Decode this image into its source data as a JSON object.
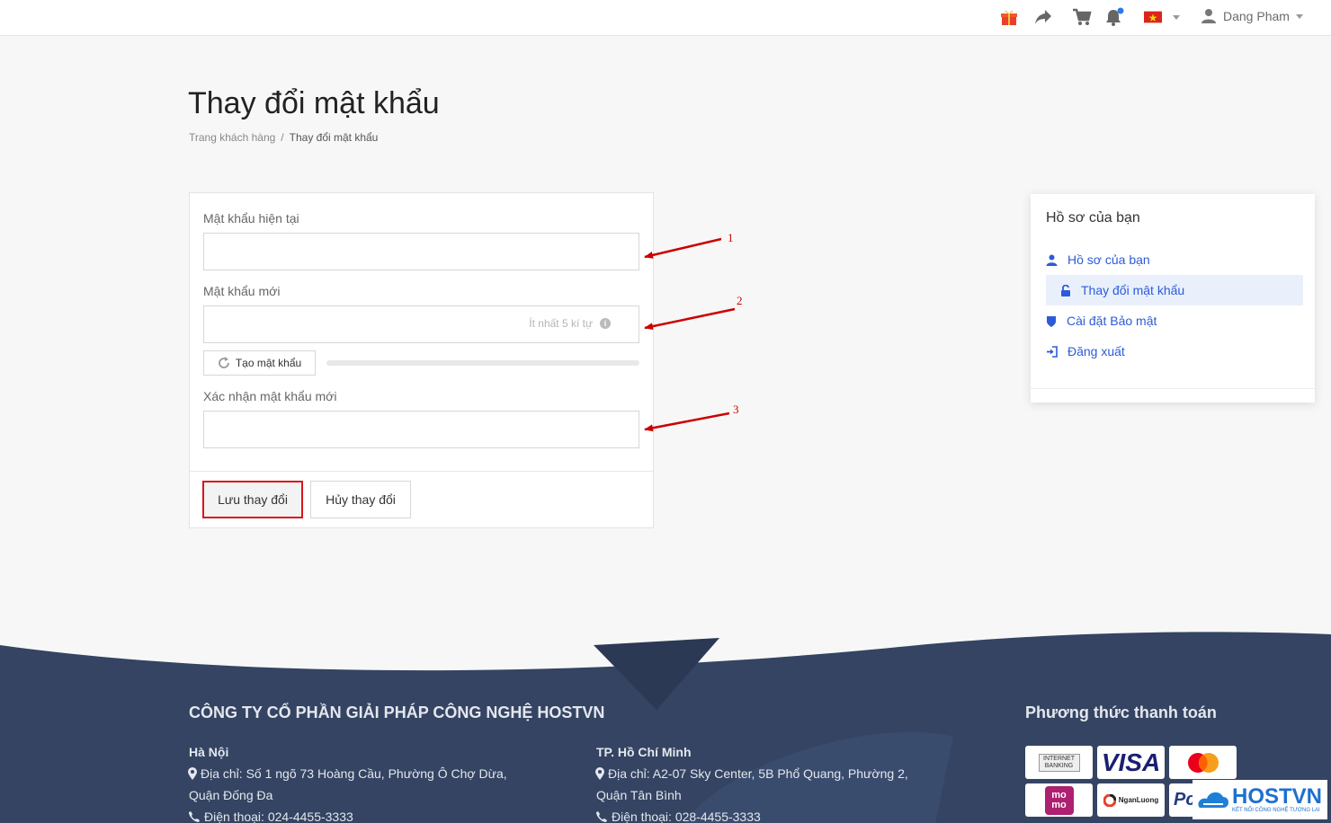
{
  "topbar": {
    "user_name": "Dang Pham",
    "icons": [
      "gift-icon",
      "share-icon",
      "cart-icon",
      "bell-icon",
      "vietnam-flag-icon",
      "user-icon"
    ]
  },
  "page": {
    "title": "Thay đổi mật khẩu",
    "breadcrumb": {
      "home": "Trang khách hàng",
      "separator": "/",
      "current": "Thay đổi mật khẩu"
    }
  },
  "form": {
    "current_label": "Mật khẩu hiện tại",
    "current_value": "",
    "new_label": "Mật khẩu mới",
    "new_value": "",
    "new_hint": "Ít nhất 5 kí tự",
    "generate_label": "Tạo mật khẩu",
    "confirm_label": "Xác nhận mật khẩu mới",
    "confirm_value": "",
    "save_label": "Lưu thay đổi",
    "cancel_label": "Hủy thay đổi"
  },
  "annotations": [
    "1",
    "2",
    "3"
  ],
  "sidebar": {
    "title": "Hồ sơ của bạn",
    "items": [
      {
        "label": "Hồ sơ của bạn",
        "icon": "user-icon"
      },
      {
        "label": "Thay đổi mật khẩu",
        "icon": "lock-icon",
        "active": true
      },
      {
        "label": "Cài đặt Bảo mật",
        "icon": "shield-icon"
      },
      {
        "label": "Đăng xuất",
        "icon": "sign-out-icon"
      }
    ]
  },
  "footer": {
    "company": "CÔNG TY CỔ PHẦN GIẢI PHÁP CÔNG NGHỆ HOSTVN",
    "payment_title": "Phương thức thanh toán",
    "hanoi": {
      "city": "Hà Nội",
      "address_1": "Địa chỉ: Số 1 ngõ 73 Hoàng Cầu, Phường Ô Chợ Dừa,",
      "address_2": "Quận Đống Đa",
      "phone": "Điện thoại: 024-4455-3333"
    },
    "hcm": {
      "city": "TP. Hồ Chí Minh",
      "address_1": "Địa chỉ: A2-07 Sky Center, 5B Phổ Quang, Phường 2,",
      "address_2": "Quận Tân Bình",
      "phone": "Điện thoại: 028-4455-3333"
    },
    "payments": {
      "internet_banking": "INTERNET BANKING",
      "visa": "VISA",
      "momo_top": "mo",
      "momo_bottom": "mo",
      "nganluong": "NganLuong",
      "paypal_partial": "Pc"
    },
    "brand": {
      "name": "HOSTVN",
      "tagline": "KẾT NỐI CÔNG NGHỆ TƯƠNG LAI"
    }
  },
  "colors": {
    "accent_blue": "#2c5bd9",
    "footer_bg": "#344462",
    "highlight_red": "#d9151b",
    "annotation_red": "#cc0000"
  }
}
